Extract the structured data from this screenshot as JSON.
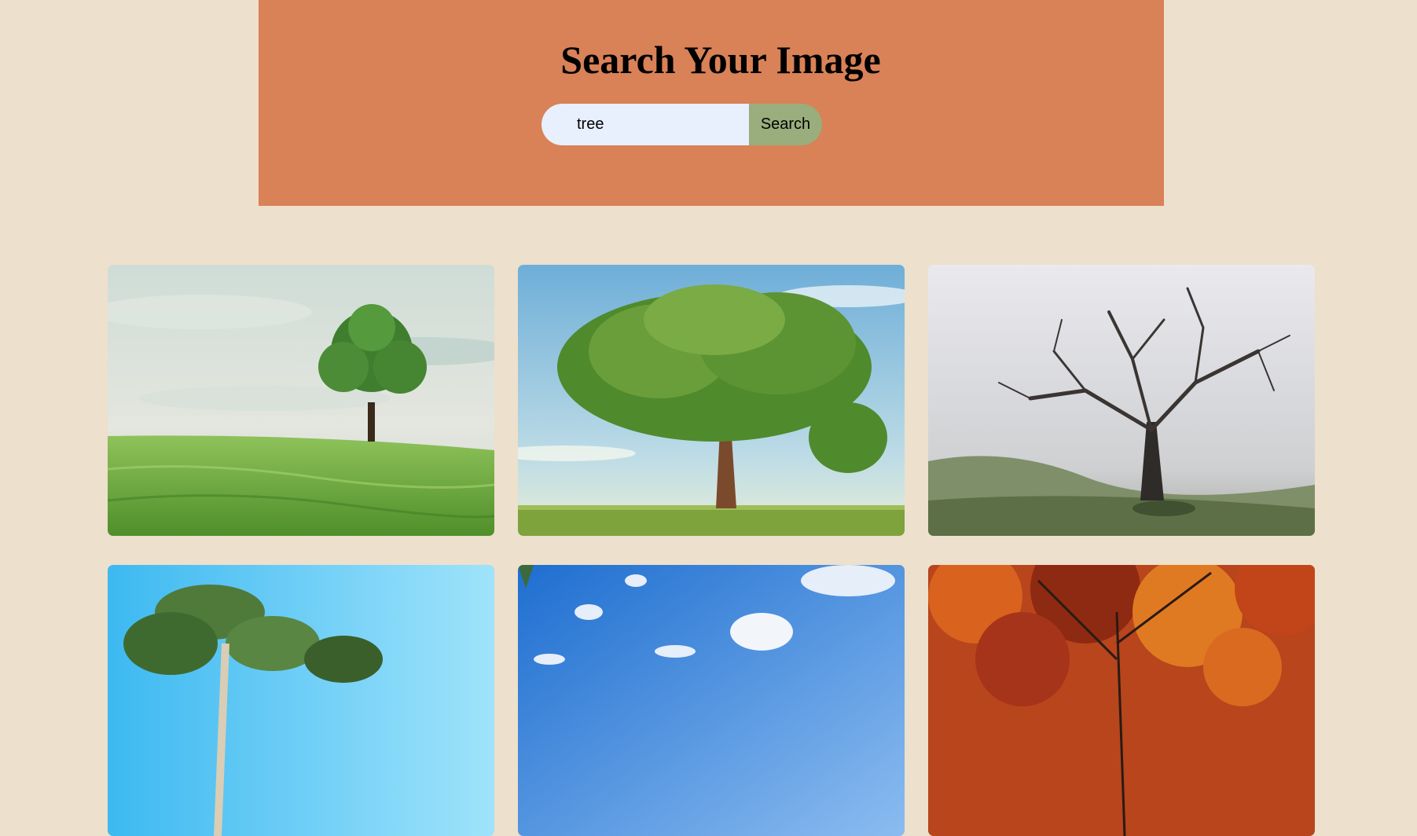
{
  "header": {
    "title": "Search Your Image",
    "background": "#d98157"
  },
  "search": {
    "value": "tree",
    "placeholder": "",
    "button_label": "Search",
    "button_color": "#99ae7c",
    "input_color": "#e8effd"
  },
  "page": {
    "background": "#ede0cc"
  },
  "results": [
    {
      "subject": "lone green tree on grassy hill"
    },
    {
      "subject": "large spreading tree under blue sky"
    },
    {
      "subject": "bare tree in fog"
    },
    {
      "subject": "eucalyptus tree against bright sky"
    },
    {
      "subject": "blue sky with scattered clouds"
    },
    {
      "subject": "autumn tree with orange leaves"
    }
  ]
}
